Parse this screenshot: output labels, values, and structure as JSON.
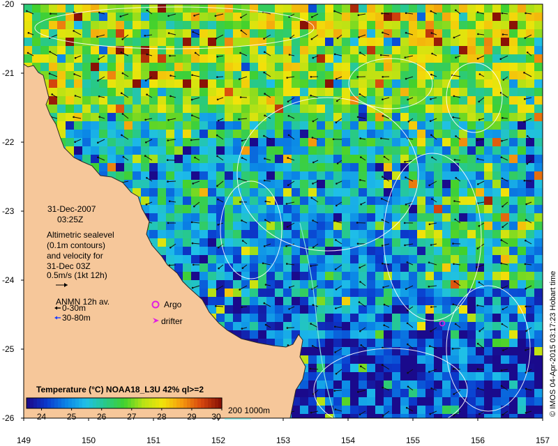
{
  "map": {
    "y_axis_labels": [
      "-20",
      "-21",
      "-22",
      "-23",
      "-24",
      "-25",
      "-26"
    ],
    "x_axis_labels": [
      "149",
      "150",
      "151",
      "152",
      "153",
      "154",
      "155",
      "156",
      "157"
    ],
    "lon_range": [
      149,
      157
    ],
    "lat_range": [
      -26,
      -20
    ],
    "land_color": "#f6c79a",
    "contour_color": "#ffffff",
    "bathy_contour_color": "#7fe3e0"
  },
  "annotations": {
    "date": "31-Dec-2007",
    "time": "03:25Z",
    "altimetry_lines": [
      "Altimetric sealevel",
      "(0.1m contours)",
      "and velocity for",
      "31-Dec 03Z"
    ],
    "scale_label": "0.5m/s (1kt 12h)",
    "anmn_title": "ANMN 12h av.",
    "anmn_shallow": "0-30m",
    "anmn_deep": "30-80m",
    "argo_label": "Argo",
    "drifter_label": "drifter",
    "anmn_shallow_color": "#000000",
    "anmn_deep_color": "#1f3fff",
    "argo_color": "#e020e0",
    "drifter_color": "#e020e0"
  },
  "colorbar": {
    "title": "Temperature (°C) NOAA18_L3U 42% ql>=2",
    "range": [
      23.5,
      30.0
    ],
    "tick_labels": [
      "24",
      "25",
      "26",
      "27",
      "28",
      "29",
      "30"
    ],
    "colors": [
      "#1a0a8c",
      "#0a3ccf",
      "#0a85e6",
      "#1fc0e8",
      "#27c98a",
      "#41d12e",
      "#b8e215",
      "#f2e40a",
      "#f59a0e",
      "#d8480e",
      "#8a1206"
    ]
  },
  "bathymetry_legend": {
    "label": "200  1000m"
  },
  "credit": "© IMOS 04-Apr-2015 03:17:23 Hobart time"
}
